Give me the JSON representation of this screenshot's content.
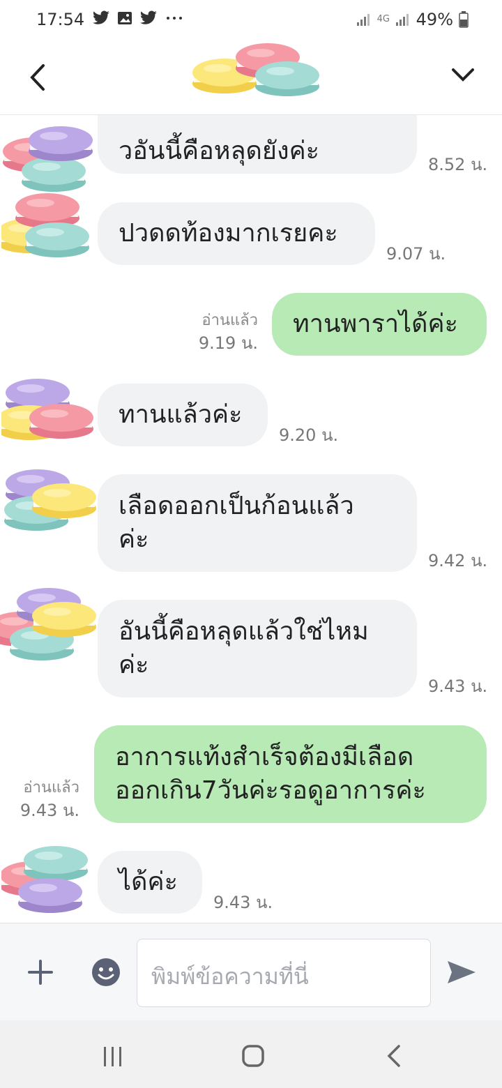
{
  "status": {
    "time": "17:54",
    "network": "4G",
    "battery": "49%"
  },
  "messages": [
    {
      "text_top": "วอันนี้คือหลุดยังค่ะ",
      "time": "8.52 น."
    },
    {
      "text": "ปวดดท้องมากเรยคะ",
      "time": "9.07 น."
    },
    {
      "text": "ทานพาราได้ค่ะ",
      "read": "อ่านแล้ว",
      "time": "9.19 น."
    },
    {
      "text": "ทานแล้วค่ะ",
      "time": "9.20 น."
    },
    {
      "line1": "เลือดออกเป็นก้อนแล้ว",
      "line2": "ค่ะ",
      "time": "9.42 น."
    },
    {
      "line1": "อันนี้คือหลุดแล้วใช่ไหม",
      "line2": "ค่ะ",
      "time": "9.43 น."
    },
    {
      "line1": "อาการแท้งสำเร็จต้องมีเลือด",
      "line2": "ออกเกิน7วันค่ะรอดูอาการค่ะ",
      "read": "อ่านแล้ว",
      "time": "9.43 น."
    },
    {
      "text": "ได้ค่ะ",
      "time": "9.43 น."
    }
  ],
  "composer": {
    "placeholder": "พิมพ์ข้อความที่นี่"
  },
  "colors": {
    "incoming_bubble": "#f1f2f4",
    "outgoing_bubble": "#b8eab6",
    "send_icon": "#6b7280"
  }
}
